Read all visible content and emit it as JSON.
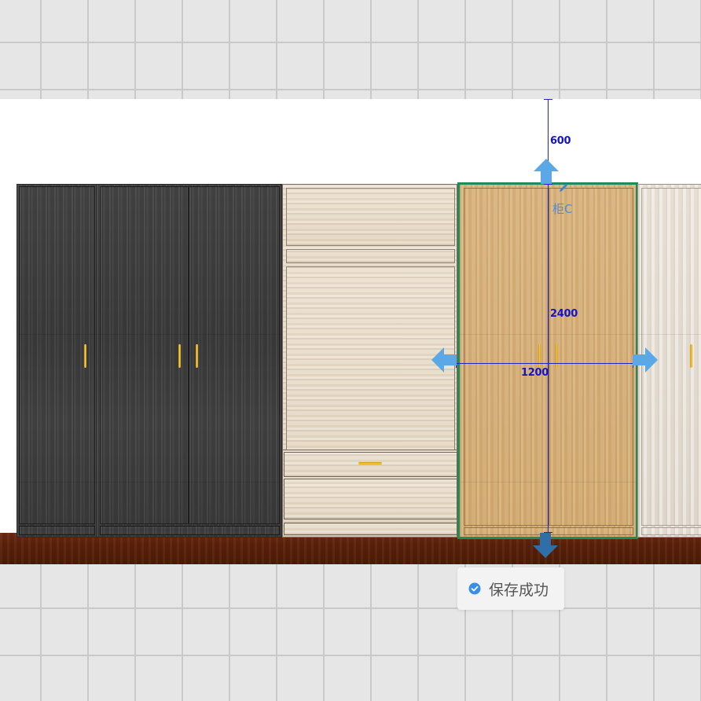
{
  "design": {
    "cabinets": [
      {
        "name": "cabinet-a",
        "finish": "dark-grey-wood",
        "doors": 1
      },
      {
        "name": "cabinet-b",
        "finish": "dark-grey-wood",
        "doors": 2
      },
      {
        "name": "cabinet-light",
        "finish": "light-ash-wood",
        "drawers": 2
      },
      {
        "name": "cabinet-c",
        "finish": "oak-wood",
        "doors": 2,
        "selected": true
      },
      {
        "name": "cabinet-pale",
        "finish": "pale-wood",
        "doors": 1
      }
    ],
    "selected_cabinet_label": "柜C",
    "dimensions": {
      "top_gap": "600",
      "height": "2400",
      "width": "1200"
    },
    "colors": {
      "selection_border": "#1f8a5a",
      "dimension_line": "#2323c8",
      "arrow": "#5aa9e6",
      "arrow_dark": "#2f6fa8",
      "handle": "#f2c230"
    }
  },
  "toast": {
    "icon": "check-circle-icon",
    "text": "保存成功"
  }
}
